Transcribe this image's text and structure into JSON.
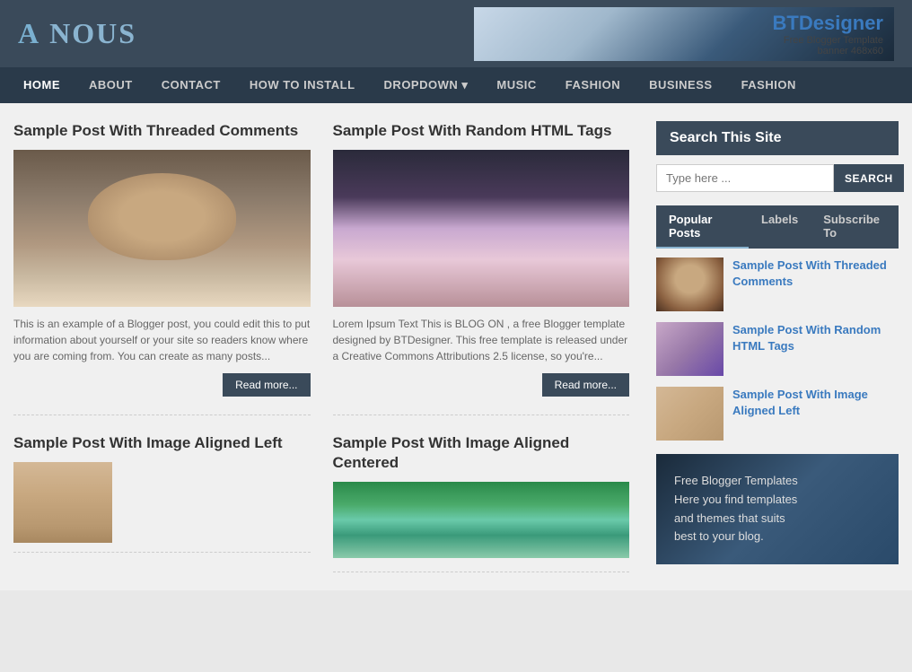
{
  "header": {
    "logo_part1": "A",
    "logo_part2": "NOUS",
    "banner_brand": "BT",
    "banner_brand2": "Designer",
    "banner_sub1": "Free Blogger Template",
    "banner_sub2": "banner 468x60"
  },
  "nav": {
    "items": [
      {
        "label": "HOME",
        "active": true
      },
      {
        "label": "ABOUT",
        "active": false
      },
      {
        "label": "CONTACT",
        "active": false
      },
      {
        "label": "HOW TO INSTALL",
        "active": false
      },
      {
        "label": "DROPDOWN ▾",
        "active": false
      },
      {
        "label": "MUSIC",
        "active": false
      },
      {
        "label": "FASHION",
        "active": false
      },
      {
        "label": "BUSINESS",
        "active": false
      },
      {
        "label": "FASHION",
        "active": false
      }
    ]
  },
  "posts": [
    {
      "title": "Sample Post With Threaded Comments",
      "excerpt": "This is an example of a Blogger post, you could edit this to put information about yourself or your site so readers know where you are coming from. You can create as many posts...",
      "read_more": "Read more..."
    },
    {
      "title": "Sample Post With Random HTML Tags",
      "excerpt": "Lorem Ipsum Text This is BLOG ON , a free Blogger template designed by BTDesigner. This free template is released under a Creative Commons Attributions 2.5 license, so you're...",
      "read_more": "Read more..."
    },
    {
      "title": "Sample Post With Image Aligned Left",
      "excerpt": "",
      "read_more": ""
    },
    {
      "title": "Sample Post With Image Aligned Centered",
      "excerpt": "",
      "read_more": ""
    }
  ],
  "sidebar": {
    "search_title": "Search This Site",
    "search_placeholder": "Type here ...",
    "search_btn": "SEARCH",
    "tabs": [
      {
        "label": "Popular Posts",
        "active": true
      },
      {
        "label": "Labels",
        "active": false
      },
      {
        "label": "Subscribe To",
        "active": false
      }
    ],
    "popular_posts": [
      {
        "title": "Sample Post With Threaded Comments"
      },
      {
        "title": "Sample Post With Random HTML Tags"
      },
      {
        "title": "Sample Post With Image Aligned Left"
      }
    ],
    "bottom_banner_line1": "Free Blogger Templates",
    "bottom_banner_line2": "Here you find templates",
    "bottom_banner_line3": "and themes that suits",
    "bottom_banner_line4": "best to your blog."
  }
}
